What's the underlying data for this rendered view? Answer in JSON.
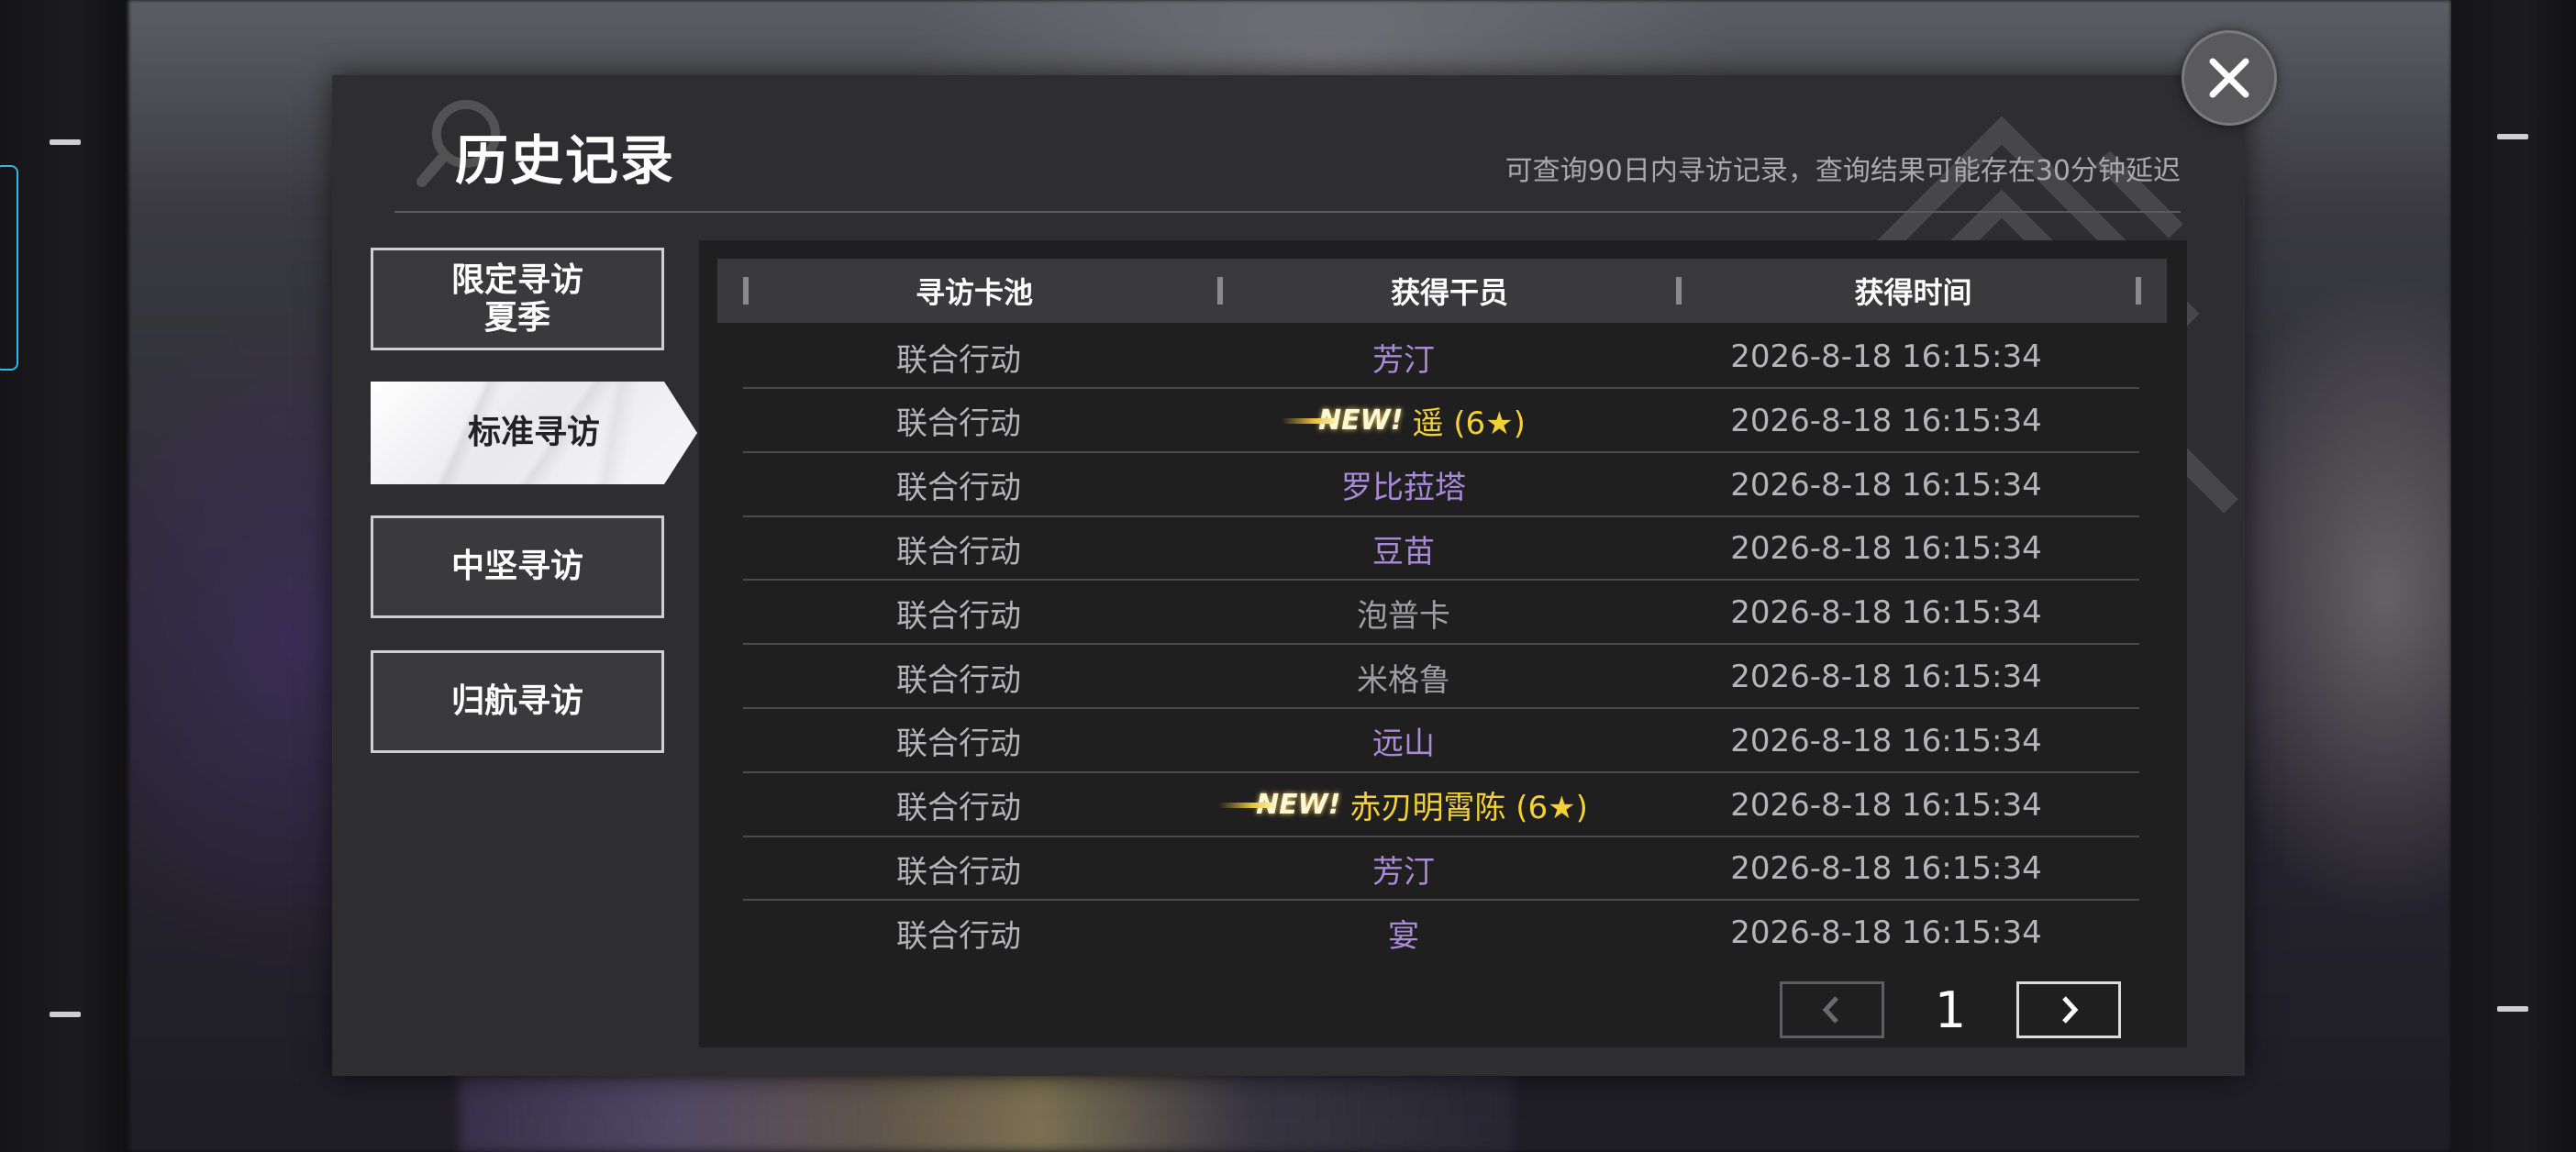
{
  "header": {
    "title": "历史记录",
    "subtitle": "可查询90日内寻访记录，查询结果可能存在30分钟延迟"
  },
  "tabs": [
    {
      "label": "限定寻访\n夏季",
      "active": false
    },
    {
      "label": "标准寻访",
      "active": true
    },
    {
      "label": "中坚寻访",
      "active": false
    },
    {
      "label": "归航寻访",
      "active": false
    }
  ],
  "table": {
    "columns": [
      "寻访卡池",
      "获得干员",
      "获得时间"
    ],
    "new_badge_label": "NEW!",
    "rows": [
      {
        "pool": "联合行动",
        "operator": "芳汀",
        "rarity_color": "purple",
        "is_new": false,
        "time": "2026-8-18 16:15:34"
      },
      {
        "pool": "联合行动",
        "operator": "遥 (6★)",
        "rarity_color": "gold",
        "is_new": true,
        "time": "2026-8-18 16:15:34"
      },
      {
        "pool": "联合行动",
        "operator": "罗比菈塔",
        "rarity_color": "purple",
        "is_new": false,
        "time": "2026-8-18 16:15:34"
      },
      {
        "pool": "联合行动",
        "operator": "豆苗",
        "rarity_color": "purple",
        "is_new": false,
        "time": "2026-8-18 16:15:34"
      },
      {
        "pool": "联合行动",
        "operator": "泡普卡",
        "rarity_color": "gray",
        "is_new": false,
        "time": "2026-8-18 16:15:34"
      },
      {
        "pool": "联合行动",
        "operator": "米格鲁",
        "rarity_color": "gray",
        "is_new": false,
        "time": "2026-8-18 16:15:34"
      },
      {
        "pool": "联合行动",
        "operator": "远山",
        "rarity_color": "purple",
        "is_new": false,
        "time": "2026-8-18 16:15:34"
      },
      {
        "pool": "联合行动",
        "operator": "赤刃明霄陈 (6★)",
        "rarity_color": "gold",
        "is_new": true,
        "time": "2026-8-18 16:15:34"
      },
      {
        "pool": "联合行动",
        "operator": "芳汀",
        "rarity_color": "purple",
        "is_new": false,
        "time": "2026-8-18 16:15:34"
      },
      {
        "pool": "联合行动",
        "operator": "宴",
        "rarity_color": "purple",
        "is_new": false,
        "time": "2026-8-18 16:15:34"
      }
    ]
  },
  "pager": {
    "current_page": "1",
    "prev_icon": "chevron-left-icon",
    "next_icon": "chevron-right-icon",
    "prev_enabled": false,
    "next_enabled": true
  },
  "colors": {
    "purple_rarity": "#a98ad8",
    "gold_rarity": "#f3d034",
    "gray_rarity": "#9f9fa1",
    "panel": "#2e2e30",
    "table": "#1f1f20"
  },
  "icons": {
    "close": "close-icon"
  }
}
